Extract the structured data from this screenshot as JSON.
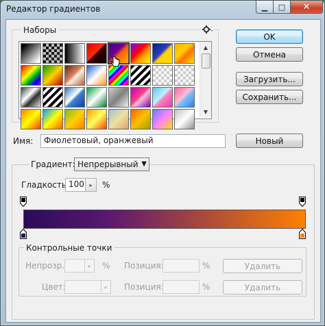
{
  "window": {
    "title": "Редактор градиентов",
    "close_glyph": "✕",
    "min_glyph": "▁",
    "max_glyph": "□"
  },
  "buttons": {
    "ok": "OK",
    "cancel": "Отмена",
    "load": "Загрузить...",
    "save": "Сохранить...",
    "new": "Новый",
    "delete": "Удалить"
  },
  "presets": {
    "label": "Наборы",
    "menu_icon": "gear-icon",
    "cursor_icon": "hand-cursor-icon",
    "swatches": [
      "linear-gradient(135deg,#000 10%,#fff 90%)",
      "checker-black",
      "linear-gradient(90deg,#000,#fff)",
      "linear-gradient(135deg,#e00000,#ff3000 45%,#3a0000 50%,#050000)",
      "linear-gradient(135deg,#40008a,#700090 40%,#ff6000 55%,#ffb000)",
      "linear-gradient(135deg,#7a00ff,#ff0000 40%,#ff9000 60%,#ffff00)",
      "linear-gradient(135deg,#002080,#3040c0 45%,#ffd000 55%,#ffe000)",
      "linear-gradient(135deg,#ffb000,#ffd000 40%,#ff7000 60%,#ffe400)",
      "linear-gradient(135deg,#ff0000,#ff8000,#ffff00,#00c000,#0000ff,#a000c0)",
      "linear-gradient(135deg,#00a000,#ffd000 50%,#c00000)",
      "linear-gradient(135deg,#5a2a12,#e08060 45%,#fff0e0 55%,#b26040)",
      "linear-gradient(135deg,#2060d0,#ffffff 50%,#ff9a30)",
      "rainbow-stripe",
      "stripe-bw",
      "checker-transparent",
      "checker-transparent",
      "linear-gradient(135deg,#404040,#ffffff 40%,#303030 60%,#e0e0e0)",
      "stripe-bw",
      "linear-gradient(135deg,#3070c0,#ffffff 45%,#4080d0 55%,#1040a0)",
      "linear-gradient(135deg,#00a040,#ffffff 50%,#008030)",
      "linear-gradient(135deg,#d0d0d0,#808080 50%,#f0f0f0)",
      "linear-gradient(135deg,#c000c0,#ff4080 45%,#ffc0e0 55%,#8000a0)",
      "linear-gradient(135deg,#60c0ff,#c0f0ff 45%,#ff80c0 55%,#e040a0)",
      "linear-gradient(135deg,#ff60a0,#ffc0d0 45%,#80c0ff 55%,#3080e0)",
      "linear-gradient(135deg,#ff8000,#ffff00 50%,#ff4000)",
      "linear-gradient(135deg,#00a0ff,#ffff00 50%,#ff6000)",
      "linear-gradient(135deg,#70c030,#ffd000 50%,#ff8000)",
      "linear-gradient(135deg,#ffa000,#ffff60 50%,#ff4000)",
      "linear-gradient(135deg,#a0c0e0,#f0e0a0 50%,#e0a070)",
      "linear-gradient(135deg,#ff6000,#ffc000 50%,#a0a000)",
      "linear-gradient(135deg,#6080ff,#ff80ff 50%,#ffe000)",
      "linear-gradient(135deg,#c0c0c0,#ffffff 50%,#909090)"
    ]
  },
  "name": {
    "label": "Имя:",
    "value": "Фиолетовый, оранжевый"
  },
  "gradient": {
    "type_label": "Градиент:",
    "type_value": "Непрерывный",
    "smooth_label": "Гладкость:",
    "smooth_value": "100",
    "percent": "%",
    "start_color": "#2b0a5a",
    "mid_color": "#5a1870",
    "end_color": "#ff8000",
    "start_stop_color": "#000000"
  },
  "stops": {
    "legend": "Контрольные точки",
    "opacity_label": "Непрозр.:",
    "location_label": "Позиция:",
    "percent": "%",
    "color_label": "Цвет:"
  }
}
